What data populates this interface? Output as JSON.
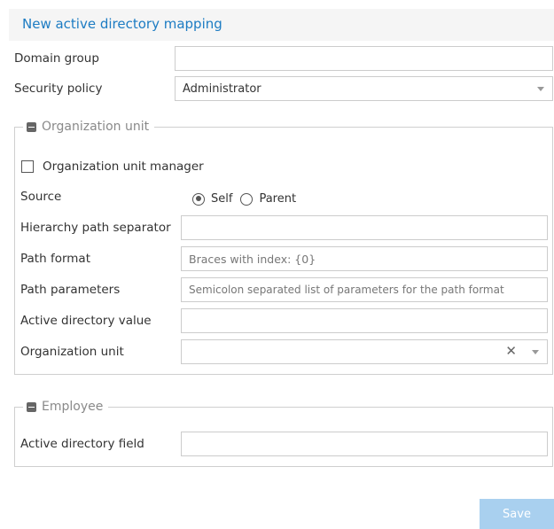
{
  "header": {
    "title": "New active directory mapping"
  },
  "form": {
    "domain_group": {
      "label": "Domain group",
      "value": ""
    },
    "security_policy": {
      "label": "Security policy",
      "value": "Administrator"
    }
  },
  "org_unit_section": {
    "legend": "Organization unit",
    "manager_checkbox": {
      "label": "Organization unit manager",
      "checked": false
    },
    "source": {
      "label": "Source",
      "options": [
        {
          "label": "Self",
          "checked": true
        },
        {
          "label": "Parent",
          "checked": false
        }
      ]
    },
    "hierarchy_path_separator": {
      "label": "Hierarchy path separator",
      "value": ""
    },
    "path_format": {
      "label": "Path format",
      "placeholder": "Braces with index: {0}"
    },
    "path_parameters": {
      "label": "Path parameters",
      "placeholder": "Semicolon separated list of parameters for the path format"
    },
    "active_directory_value": {
      "label": "Active directory value",
      "value": ""
    },
    "organization_unit": {
      "label": "Organization unit",
      "value": ""
    }
  },
  "employee_section": {
    "legend": "Employee",
    "active_directory_field": {
      "label": "Active directory field",
      "value": ""
    }
  },
  "actions": {
    "save_label": "Save"
  },
  "colors": {
    "title": "#1d7cc3",
    "save_button_bg": "#a9d0ef",
    "header_bg": "#f5f5f5"
  },
  "icons": {
    "section_toggle": "collapse-minus-icon",
    "select_caret": "chevron-down-icon",
    "clear": "close-icon"
  }
}
